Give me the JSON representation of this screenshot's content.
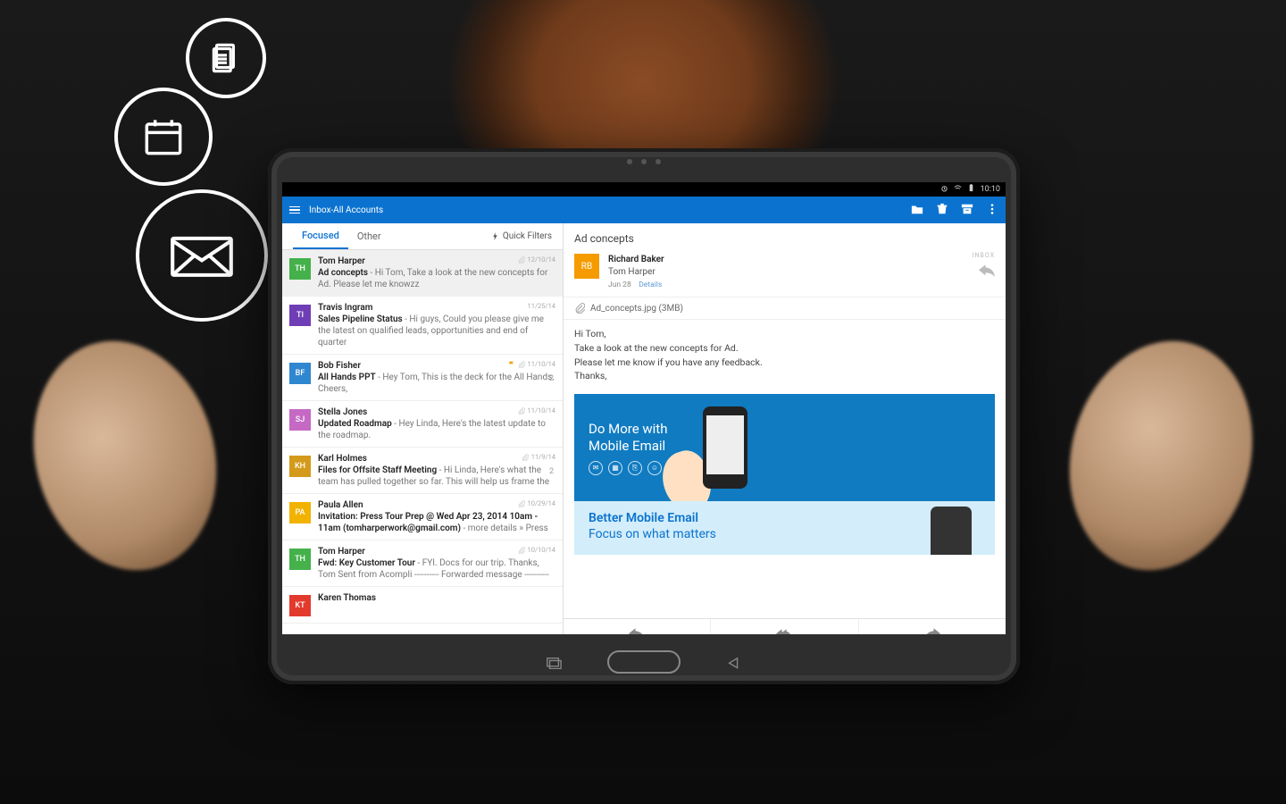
{
  "status": {
    "time": "10:10"
  },
  "header": {
    "title": "Inbox-All Accounts"
  },
  "tabs": {
    "focused": "Focused",
    "other": "Other",
    "quick_filters": "Quick Filters"
  },
  "messages": [
    {
      "initials": "TH",
      "color": "#45b14b",
      "sender": "Tom Harper",
      "subject": "Ad concepts",
      "preview": " - Hi Tom, Take a look at the new concepts for Ad. Please let me knowzz",
      "date": "12/10/14",
      "flag": false,
      "attach": true,
      "count": "",
      "selected": true
    },
    {
      "initials": "TI",
      "color": "#6f3db6",
      "sender": "Travis Ingram",
      "subject": "Sales Pipeline Status",
      "preview": " - Hi guys, Could you please give me the latest on qualified leads, opportunities and end of quarter",
      "date": "11/25/14",
      "flag": false,
      "attach": false,
      "count": "",
      "selected": false
    },
    {
      "initials": "BF",
      "color": "#2f87d0",
      "sender": "Bob Fisher",
      "subject": "All Hands PPT",
      "preview": " - Hey Tom, This is the deck for the All Hands. Cheers,",
      "date": "11/10/14",
      "flag": true,
      "attach": true,
      "count": "2",
      "selected": false
    },
    {
      "initials": "SJ",
      "color": "#c569c4",
      "sender": "Stella Jones",
      "subject": "Updated Roadmap",
      "preview": " - Hey Linda, Here's the latest update to the roadmap.",
      "date": "11/10/14",
      "flag": false,
      "attach": true,
      "count": "",
      "selected": false
    },
    {
      "initials": "KH",
      "color": "#d39a1b",
      "sender": "Karl Holmes",
      "subject": "Files for Offsite Staff Meeting",
      "preview": " - Hi Linda, Here's what the team has pulled together so far. This will help us frame the",
      "date": "11/9/14",
      "flag": false,
      "attach": true,
      "count": "2",
      "selected": false
    },
    {
      "initials": "PA",
      "color": "#f2b200",
      "sender": "Paula Allen",
      "subject": "Invitation: Press Tour Prep @ Wed Apr 23, 2014 10am - 11am (tomharperwork@gmail.com)",
      "preview": " - more details » Press",
      "date": "10/29/14",
      "flag": false,
      "attach": true,
      "count": "",
      "selected": false
    },
    {
      "initials": "TH",
      "color": "#45b14b",
      "sender": "Tom Harper",
      "subject": "Fwd: Key Customer Tour",
      "preview": " - FYI. Docs for our trip. Thanks, Tom Sent from Acompli ---------- Forwarded message ----------",
      "date": "10/10/14",
      "flag": false,
      "attach": true,
      "count": "",
      "selected": false
    },
    {
      "initials": "KT",
      "color": "#e23b2e",
      "sender": "Karen Thomas",
      "subject": "",
      "preview": "",
      "date": "",
      "flag": false,
      "attach": false,
      "count": "",
      "selected": false
    }
  ],
  "reading": {
    "subject": "Ad concepts",
    "from_initials": "RB",
    "from": "Richard Baker",
    "to": "Tom Harper",
    "date": "Jun 28",
    "details": "Details",
    "folder": "INBOX",
    "attachment": "Ad_concepts.jpg (3MB)",
    "body_greeting": "Hi Tom,",
    "body_line1": "Take a look at the new concepts for Ad.",
    "body_line2": "Please let me know if you have any feedback.",
    "body_signoff": "Thanks,",
    "promo1_line1": "Do More with",
    "promo1_line2": "Mobile Email",
    "promo2_line1": "Better Mobile Email",
    "promo2_line2": "Focus on what matters"
  }
}
